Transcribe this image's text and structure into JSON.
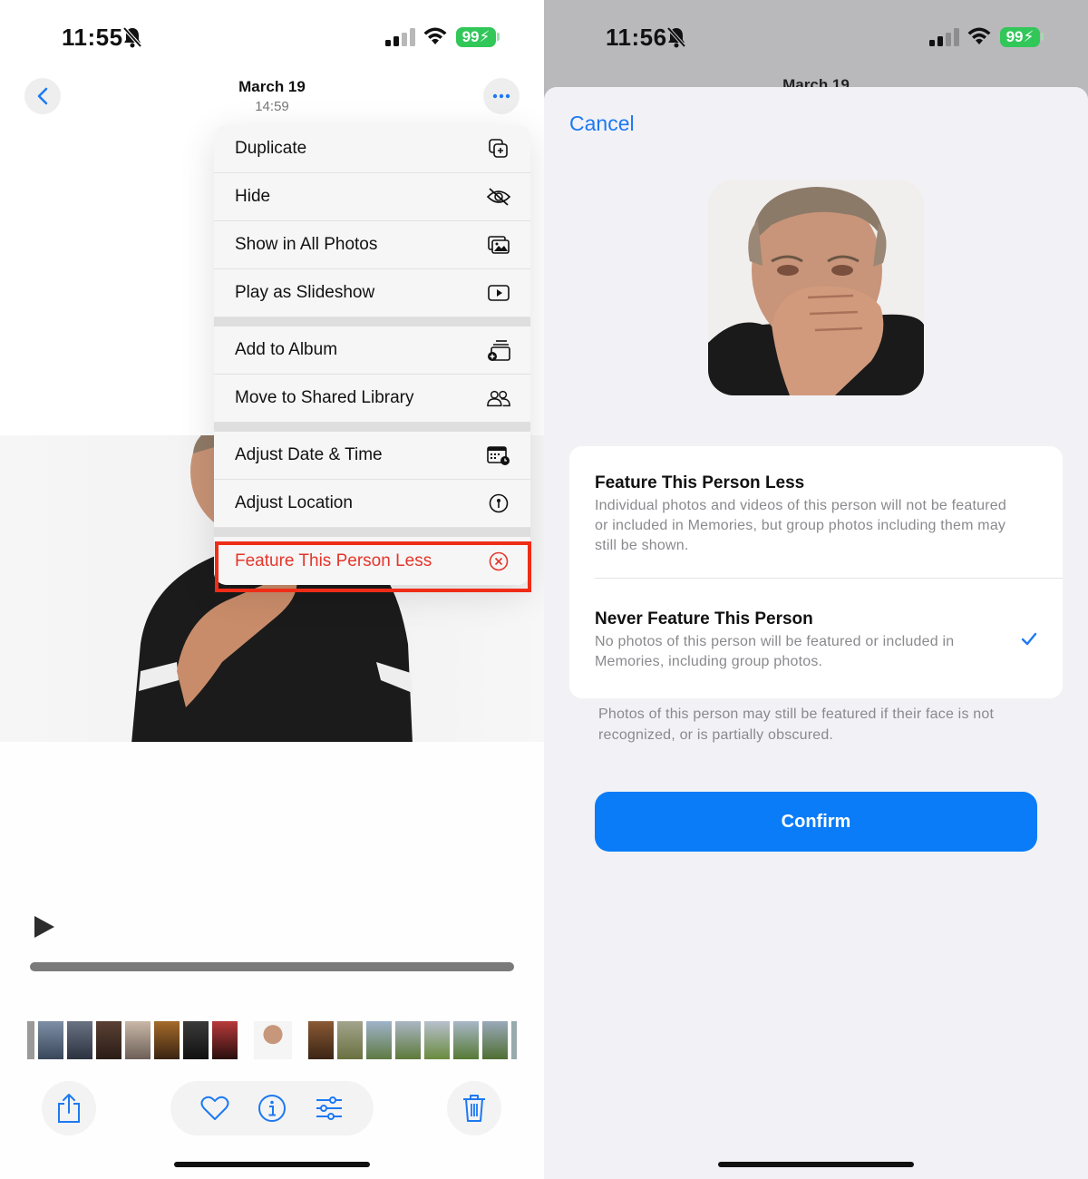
{
  "left": {
    "status": {
      "time": "11:55",
      "battery": "99"
    },
    "header": {
      "date": "March 19",
      "time": "14:59"
    },
    "menu": {
      "group1": [
        {
          "label": "Duplicate",
          "icon": "duplicate-icon"
        },
        {
          "label": "Hide",
          "icon": "eye-slash-icon"
        },
        {
          "label": "Show in All Photos",
          "icon": "photos-icon"
        },
        {
          "label": "Play as Slideshow",
          "icon": "slideshow-icon"
        }
      ],
      "group2": [
        {
          "label": "Add to Album",
          "icon": "add-album-icon"
        },
        {
          "label": "Move to Shared Library",
          "icon": "people-icon"
        }
      ],
      "group3": [
        {
          "label": "Adjust Date & Time",
          "icon": "calendar-icon"
        },
        {
          "label": "Adjust Location",
          "icon": "location-icon"
        }
      ],
      "danger": {
        "label": "Feature This Person Less",
        "icon": "x-circle-icon"
      }
    },
    "highlight_color": "#ef2d17"
  },
  "right": {
    "status": {
      "time": "11:56",
      "battery": "99"
    },
    "peek_title": "March 19",
    "cancel": "Cancel",
    "option1": {
      "title": "Feature This Person Less",
      "desc": "Individual photos and videos of this person will not be featured or included in Memories, but group photos including them may still be shown."
    },
    "option2": {
      "title": "Never Feature This Person",
      "desc": "No photos of this person will be featured or included in Memories, including group photos.",
      "selected": true
    },
    "footnote": "Photos of this person may still be featured if their face is not recognized, or is partially obscured.",
    "confirm": "Confirm",
    "accent": "#0a7cf7"
  }
}
